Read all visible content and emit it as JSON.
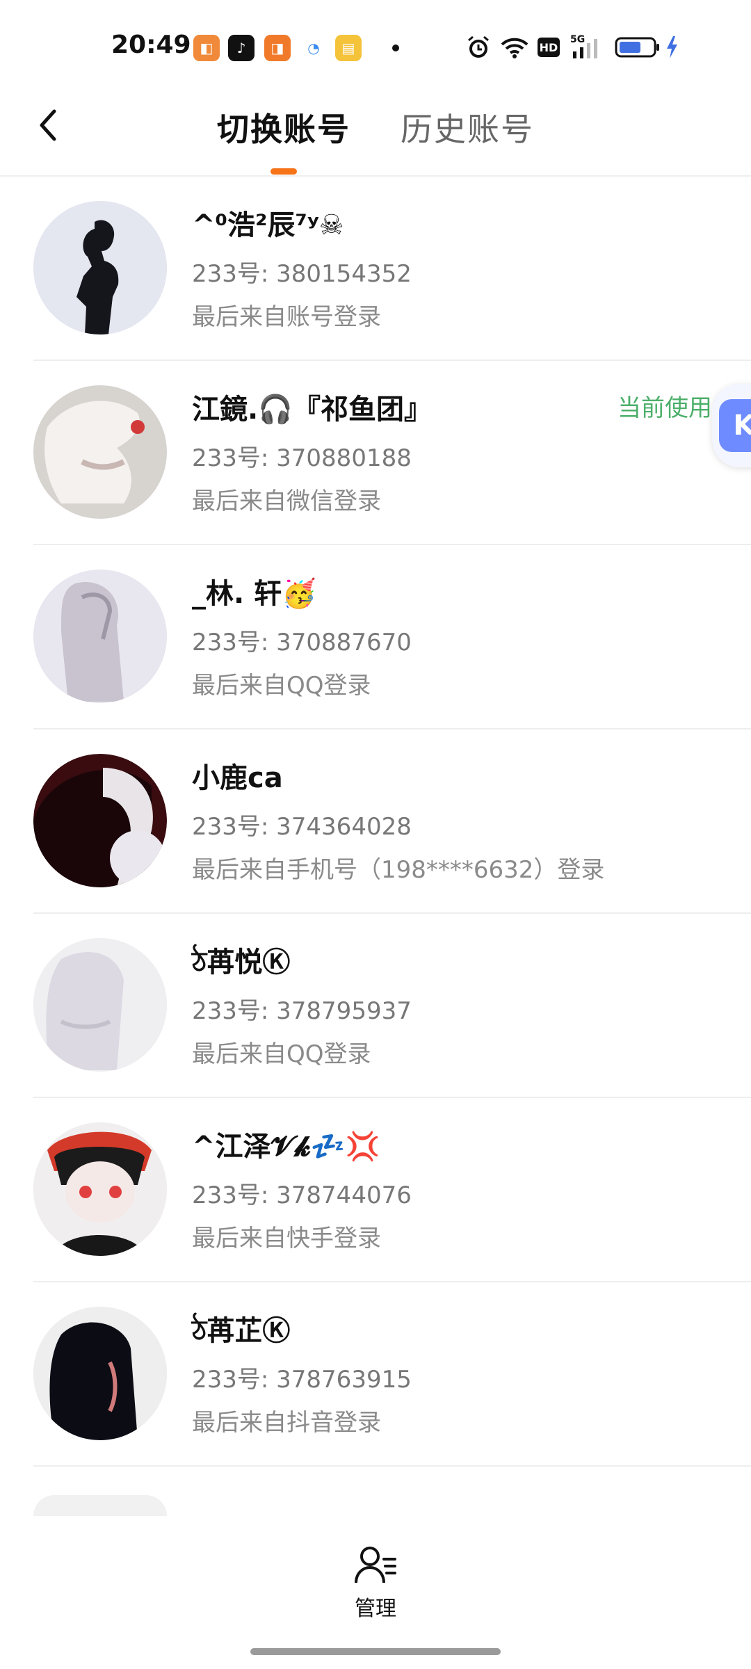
{
  "status_bar": {
    "time": "20:49",
    "icons": [
      "app-icon-1",
      "tiktok-icon",
      "app-icon-3",
      "search-app-icon",
      "notes-app-icon",
      "alarm-icon",
      "wifi-icon",
      "hd-icon",
      "signal-5g-icon",
      "battery-icon",
      "charging-icon"
    ]
  },
  "header": {
    "tabs": [
      {
        "label": "切换账号",
        "active": true
      },
      {
        "label": "历史账号",
        "active": false
      }
    ]
  },
  "accounts": [
    {
      "name": "^⁰浩²辰⁷ʸ☠",
      "uid": "233号: 380154352",
      "last_login": "最后来自账号登录",
      "current": ""
    },
    {
      "name": "江鏡.🎧『祁鱼团』",
      "uid": "233号: 370880188",
      "last_login": "最后来自微信登录",
      "current": "当前使用"
    },
    {
      "name": "_林. 轩🥳",
      "uid": "233号: 370887670",
      "last_login": "最后来自QQ登录",
      "current": ""
    },
    {
      "name": "小鹿ca",
      "uid": "233号: 374364028",
      "last_login": "最后来自手机号（198****6632）登录",
      "current": ""
    },
    {
      "name": "ঠ苒悦Ⓚ",
      "uid": "233号: 378795937",
      "last_login": "最后来自QQ登录",
      "current": ""
    },
    {
      "name": "^江泽𝓥𝓴💤💢",
      "uid": "233号: 378744076",
      "last_login": "最后来自快手登录",
      "current": ""
    },
    {
      "name": "ঠ苒芷Ⓚ",
      "uid": "233号: 378763915",
      "last_login": "最后来自抖音登录",
      "current": ""
    }
  ],
  "floating_button": {
    "label": "K"
  },
  "bottom_bar": {
    "manage_label": "管理"
  }
}
